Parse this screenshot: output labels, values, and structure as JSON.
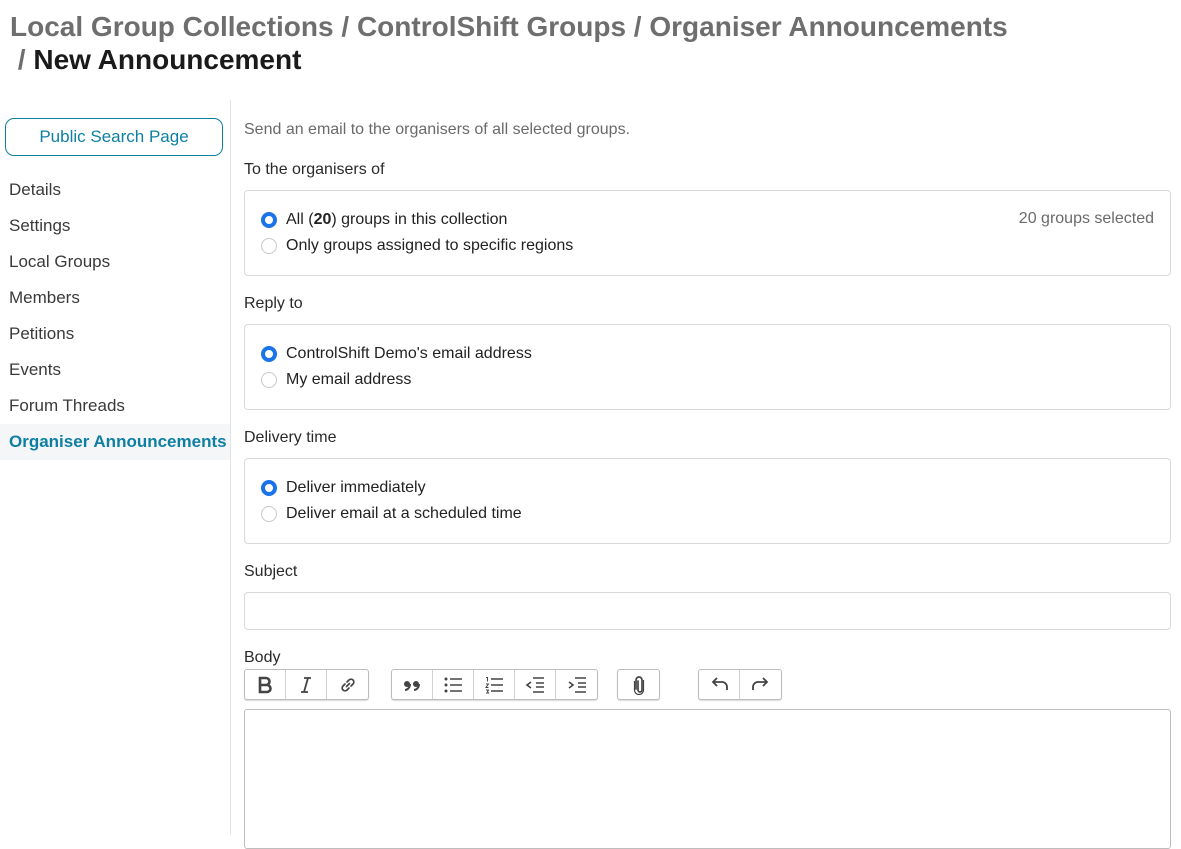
{
  "breadcrumb": {
    "items": [
      "Local Group Collections",
      "ControlShift Groups",
      "Organiser Announcements"
    ],
    "separator": "/",
    "current": "New Announcement"
  },
  "sidebar": {
    "public_button": "Public Search Page",
    "items": [
      {
        "label": "Details"
      },
      {
        "label": "Settings"
      },
      {
        "label": "Local Groups"
      },
      {
        "label": "Members"
      },
      {
        "label": "Petitions"
      },
      {
        "label": "Events"
      },
      {
        "label": "Forum Threads"
      },
      {
        "label": "Organiser Announcements",
        "active": true
      }
    ]
  },
  "form": {
    "intro": "Send an email to the organisers of all selected groups.",
    "recipients": {
      "label": "To the organisers of",
      "option_all_prefix": "All (",
      "option_all_count": "20",
      "option_all_suffix": ") groups in this collection",
      "option_regions": "Only groups assigned to specific regions",
      "selected_count": "20 groups selected",
      "selected": "all"
    },
    "reply_to": {
      "label": "Reply to",
      "option_org": "ControlShift Demo's email address",
      "option_mine": "My email address",
      "selected": "org"
    },
    "delivery": {
      "label": "Delivery time",
      "option_now": "Deliver immediately",
      "option_scheduled": "Deliver email at a scheduled time",
      "selected": "now"
    },
    "subject": {
      "label": "Subject",
      "value": ""
    },
    "body": {
      "label": "Body",
      "value": "",
      "toolbar": [
        "bold-icon",
        "italic-icon",
        "link-icon",
        "quote-icon",
        "bullet-list-icon",
        "numbered-list-icon",
        "outdent-icon",
        "indent-icon",
        "attach-icon",
        "undo-icon",
        "redo-icon"
      ]
    }
  },
  "colors": {
    "accent": "#0e7fa3",
    "radio": "#1a73e8"
  }
}
